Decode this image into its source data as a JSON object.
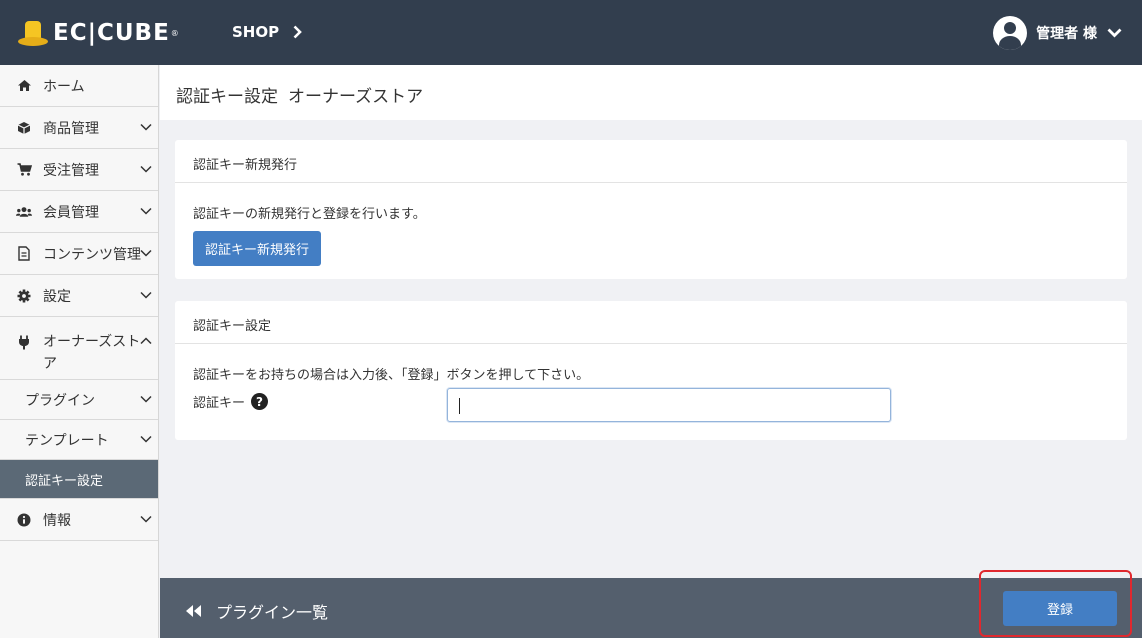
{
  "header": {
    "logo_text": "EC|CUBE",
    "logo_mark": "®",
    "shop_label": "SHOP",
    "user_label": "管理者 様",
    "icons": {
      "logo": "ec-cube-hat-logo",
      "shop_chevron": "chevron-right-icon",
      "user": "user-circle-icon",
      "user_menu": "chevron-down-icon"
    }
  },
  "sidebar": {
    "items": [
      {
        "label": "ホーム",
        "icon": "home-icon"
      },
      {
        "label": "商品管理",
        "icon": "cube-icon"
      },
      {
        "label": "受注管理",
        "icon": "cart-icon"
      },
      {
        "label": "会員管理",
        "icon": "users-icon"
      },
      {
        "label": "コンテンツ管理",
        "icon": "file-icon"
      },
      {
        "label": "設定",
        "icon": "gear-icon"
      },
      {
        "label": "オーナーズストア",
        "icon": "plug-icon"
      },
      {
        "label": "情報",
        "icon": "info-icon"
      }
    ],
    "sub_items": [
      {
        "label": "プラグイン"
      },
      {
        "label": "テンプレート"
      },
      {
        "label": "認証キー設定",
        "active": true
      }
    ]
  },
  "page": {
    "title": "認証キー設定",
    "subtitle": "オーナーズストア"
  },
  "card_new_key": {
    "heading": "認証キー新規発行",
    "description": "認証キーの新規発行と登録を行います。",
    "button_label": "認証キー新規発行"
  },
  "card_key_settings": {
    "heading": "認証キー設定",
    "description": "認証キーをお持ちの場合は入力後、「登録」ボタンを押して下さい。",
    "field_label": "認証キー",
    "help_glyph": "?",
    "field_value": ""
  },
  "footer": {
    "back_label": "プラグイン一覧",
    "save_label": "登録"
  },
  "colors": {
    "header_bg": "#323e4e",
    "footer_bg": "#545f6d",
    "primary": "#437ec4",
    "active_nav": "#5b6976",
    "highlight": "#e0282e"
  }
}
